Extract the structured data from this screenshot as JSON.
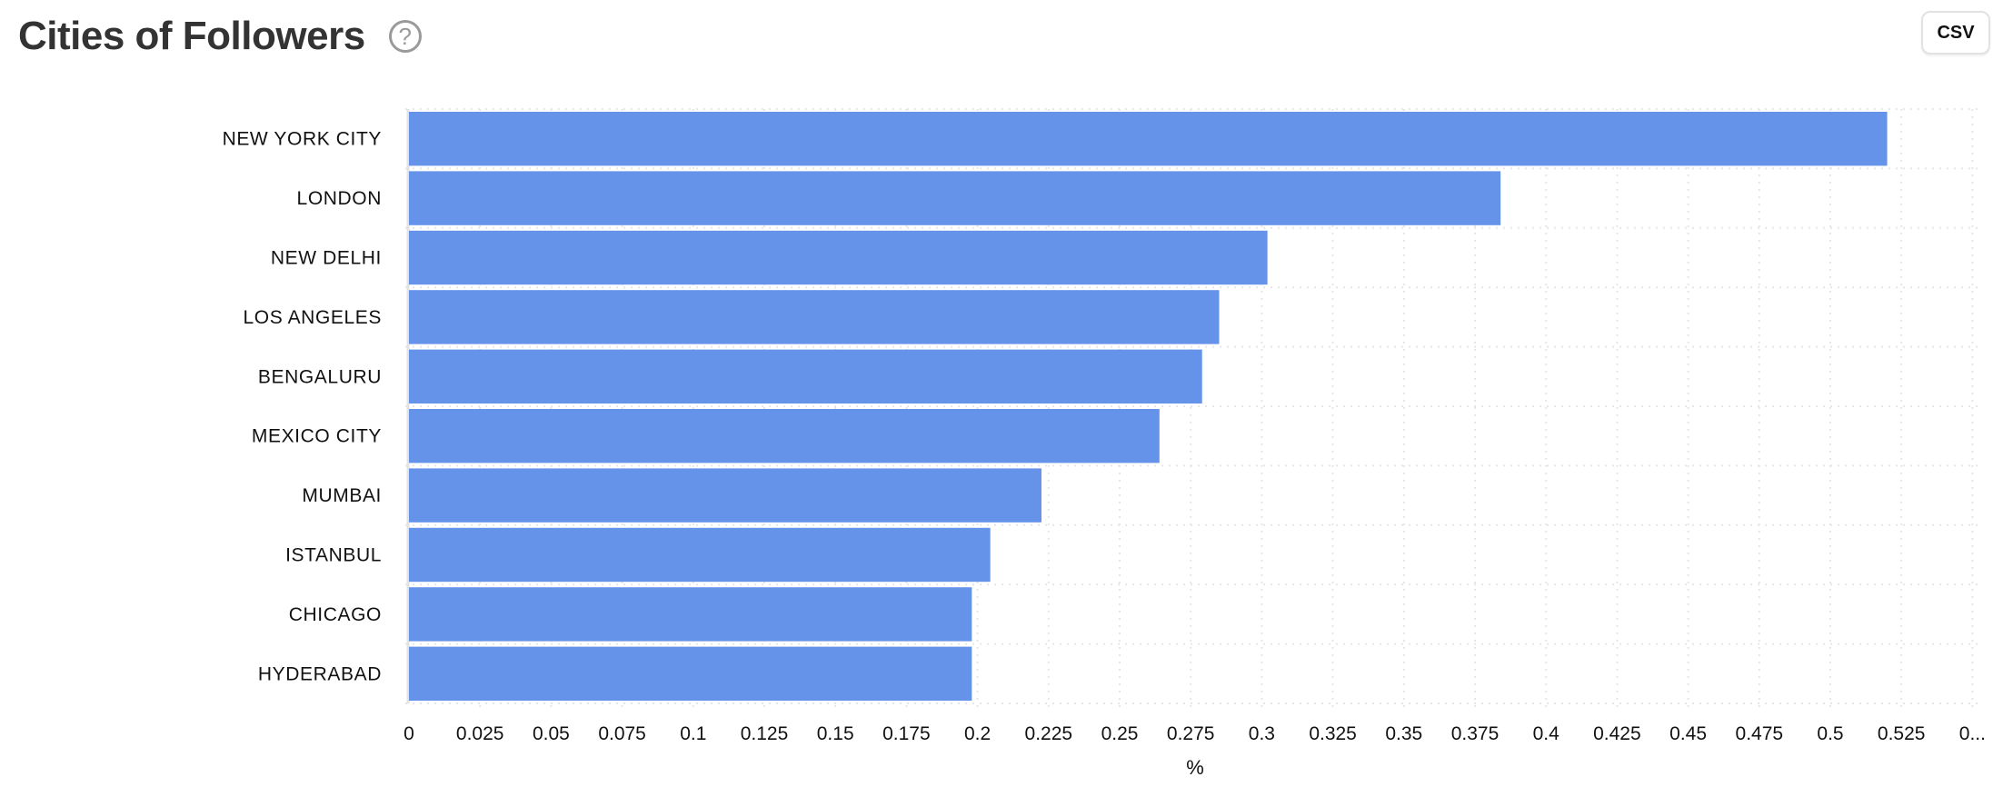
{
  "header": {
    "title": "Cities of Followers",
    "help_icon": "question-circle-icon",
    "csv_label": "CSV"
  },
  "chart_data": {
    "type": "bar",
    "orientation": "horizontal",
    "title": "Cities of Followers",
    "xlabel": "%",
    "ylabel": "",
    "categories": [
      "NEW YORK CITY",
      "LONDON",
      "NEW DELHI",
      "LOS ANGELES",
      "BENGALURU",
      "MEXICO CITY",
      "MUMBAI",
      "ISTANBUL",
      "CHICAGO",
      "HYDERABAD"
    ],
    "values": [
      0.52,
      0.384,
      0.302,
      0.285,
      0.279,
      0.264,
      0.2225,
      0.2045,
      0.198,
      0.198
    ],
    "xlim": [
      0,
      0.55
    ],
    "x_ticks": [
      0,
      0.025,
      0.05,
      0.075,
      0.1,
      0.125,
      0.15,
      0.175,
      0.2,
      0.225,
      0.25,
      0.275,
      0.3,
      0.325,
      0.35,
      0.375,
      0.4,
      0.425,
      0.45,
      0.475,
      0.5,
      0.525,
      0.55
    ],
    "x_tick_labels": [
      "0",
      "0.025",
      "0.05",
      "0.075",
      "0.1",
      "0.125",
      "0.15",
      "0.175",
      "0.2",
      "0.225",
      "0.25",
      "0.275",
      "0.3",
      "0.325",
      "0.35",
      "0.375",
      "0.4",
      "0.425",
      "0.45",
      "0.475",
      "0.5",
      "0.525",
      "0..."
    ],
    "grid": true,
    "legend": "none",
    "bar_color": "#6593ea",
    "grid_color": "#e6e6e6"
  }
}
